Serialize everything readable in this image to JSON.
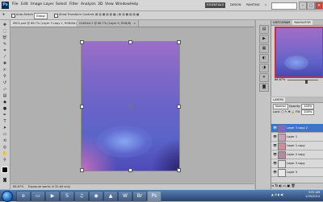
{
  "app": {
    "logo": "Ps",
    "menu": [
      "File",
      "Edit",
      "Image",
      "Layer",
      "Select",
      "Filter",
      "Analysis",
      "3D",
      "View",
      "Window",
      "Help"
    ],
    "workspace_buttons": [
      "ESSENTIALS",
      "DESIGN",
      "PAINTING",
      "»"
    ],
    "search_placeholder": ""
  },
  "options_bar": {
    "auto_select_label": "Auto-Select:",
    "auto_select_value": "Group",
    "show_transform_label": "Show Transform Controls"
  },
  "tabs": [
    {
      "label": "IMG1.psd @ 66.7% (Layer 3 copy 2, RGB/8#)",
      "close": "×",
      "active": true
    },
    {
      "label": "Untitled-1 @ 66.7% (Layer 4, RGB/8)",
      "close": "×",
      "active": false
    }
  ],
  "status": {
    "zoom": "66.67%",
    "doc": "Exposure works in 32-bit only"
  },
  "navigator": {
    "tabs": [
      "NAVIGATOR",
      "HISTOGRAM"
    ],
    "zoom": "66.67%"
  },
  "layers": {
    "tabs": [
      "LAYERS"
    ],
    "blend_mode": "Normal",
    "opacity_label": "Opacity:",
    "opacity_value": "100%",
    "lock_label": "Lock:",
    "fill_label": "Fill:",
    "fill_value": "100%",
    "items": [
      {
        "name": "Layer 3 copy 2",
        "selected": true,
        "thumb_color": "#7e67c8"
      },
      {
        "name": "Layer 1",
        "selected": false,
        "thumb_color": "#c9a0b8"
      },
      {
        "name": "Layer 1 copy",
        "selected": false,
        "thumb_color": "#c7909c"
      },
      {
        "name": "Layer 2 copy",
        "selected": false,
        "thumb_color": "#b58aa0"
      },
      {
        "name": "Layer 3 copy",
        "selected": false,
        "thumb_color": "#e0e0e0"
      },
      {
        "name": "Layer 3",
        "selected": false,
        "thumb_color": "#e8e8e8"
      }
    ],
    "bottom_icons": "∞  fx  ◐  ▭  ▣  🗑"
  },
  "taskbar": {
    "apps": [
      "ie-icon",
      "explorer-icon",
      "mediaplayer-icon",
      "skype-icon",
      "itunes-icon",
      "chrome-icon",
      "vlc-icon",
      "word-icon",
      "bridge-icon",
      "photoshop-icon"
    ],
    "time": "3:55 AM",
    "date": "1/20/2014"
  }
}
